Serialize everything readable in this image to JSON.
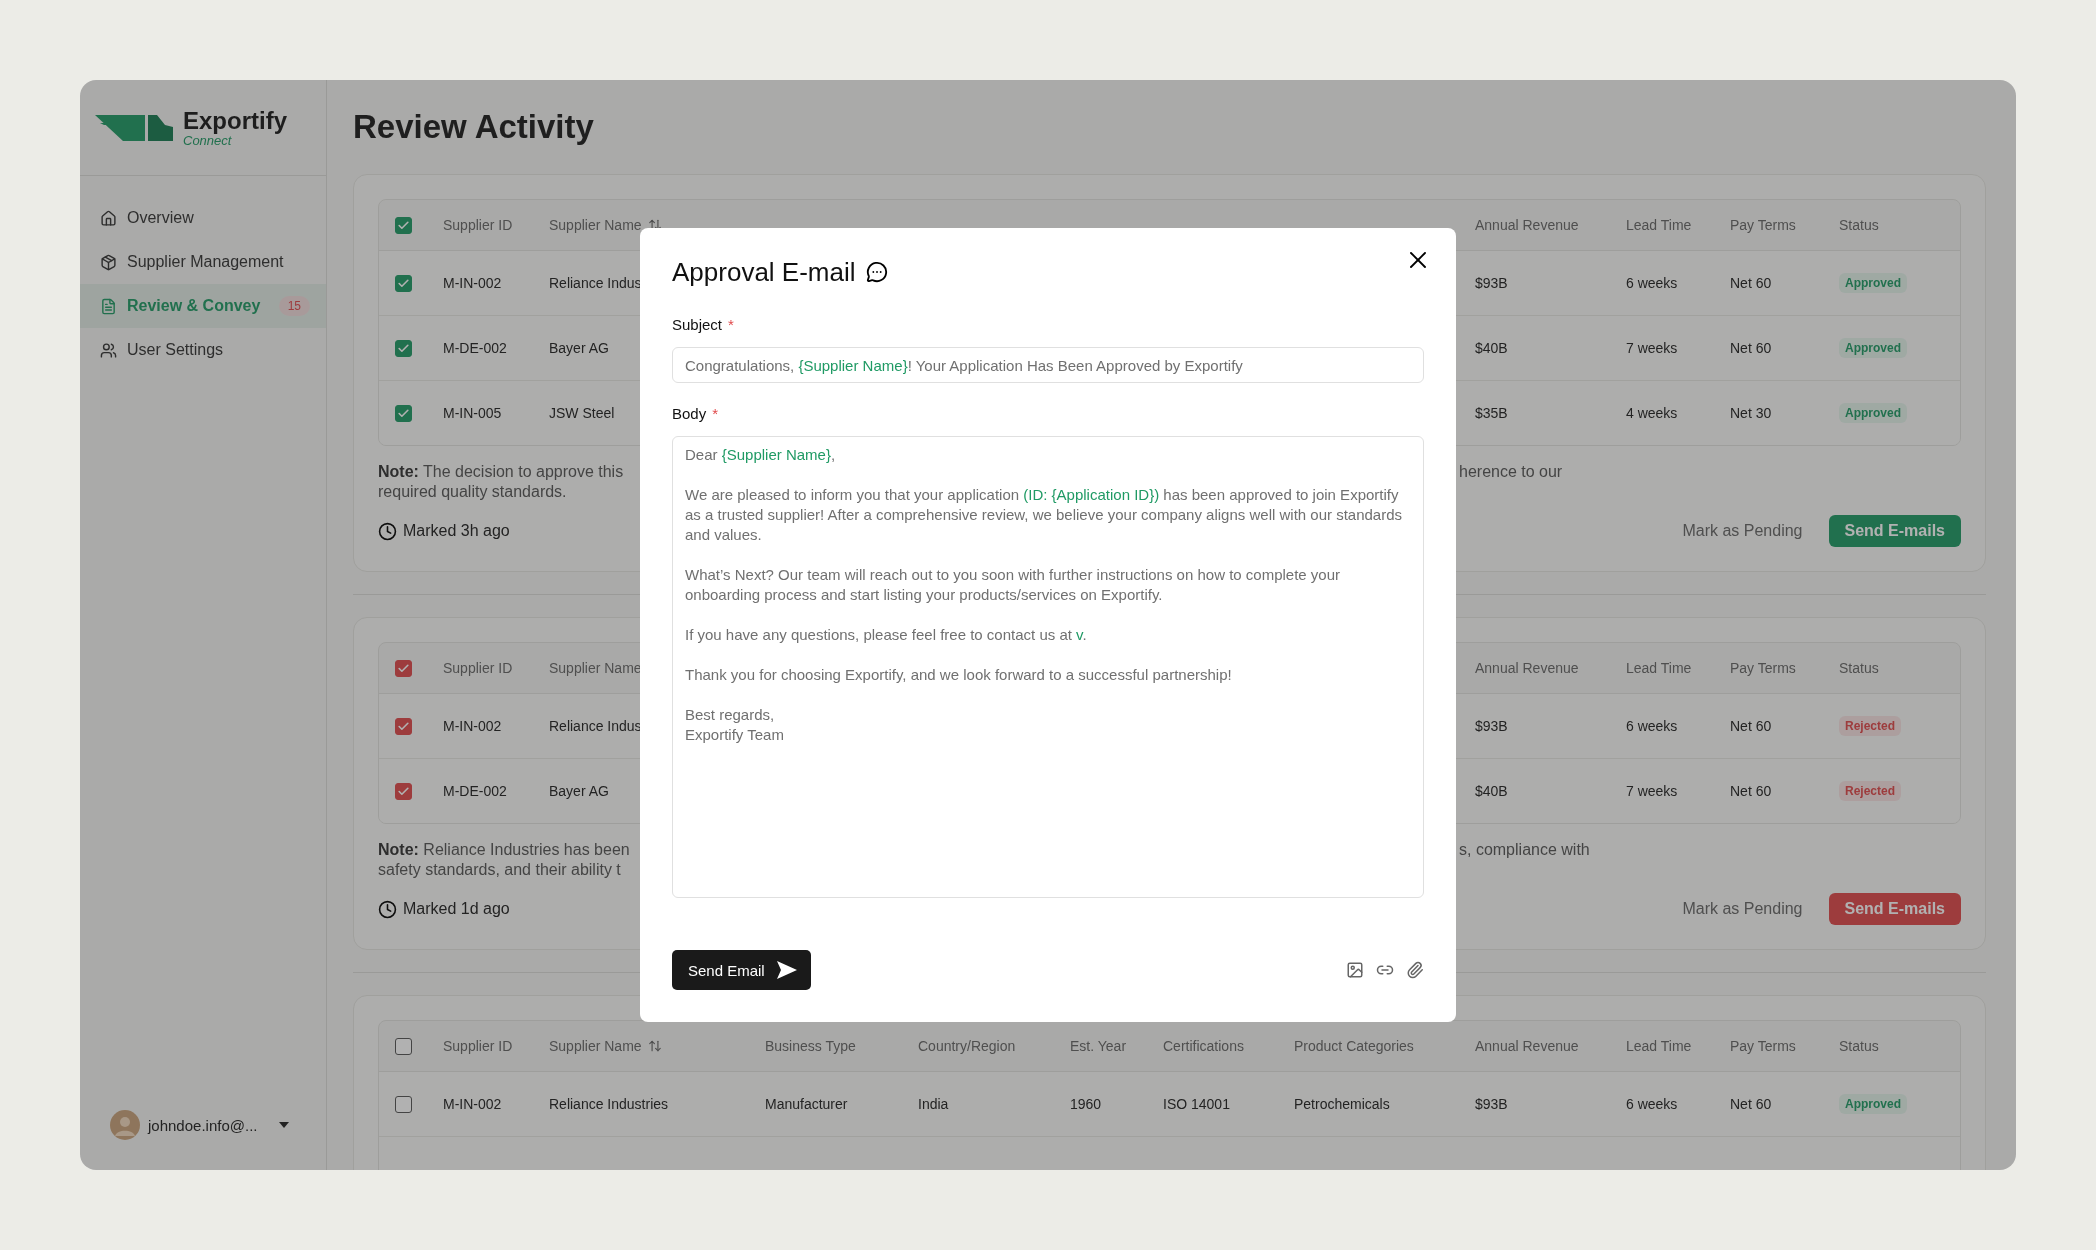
{
  "sidebar": {
    "logo": {
      "name": "Exportify",
      "tagline": "Connect"
    },
    "items": [
      {
        "label": "Overview",
        "selected": false
      },
      {
        "label": "Supplier Management",
        "selected": false
      },
      {
        "label": "Review & Convey",
        "selected": true,
        "badge": "15"
      },
      {
        "label": "User Settings",
        "selected": false
      }
    ],
    "user": {
      "email": "johndoe.info@..."
    }
  },
  "page": {
    "title": "Review Activity"
  },
  "sections": [
    {
      "kind": "approve",
      "table": {
        "checked": true,
        "sort_icon": true,
        "header": {
          "supplier_id": "Supplier ID",
          "supplier_name": "Supplier Name",
          "annual_revenue": "Annual Revenue",
          "lead_time": "Lead Time",
          "pay_terms": "Pay Terms",
          "status": "Status"
        },
        "rows": [
          {
            "checked": true,
            "supplier_id": "M-IN-002",
            "supplier_name": "Reliance Indus",
            "annual_revenue": "$93B",
            "lead_time": "6 weeks",
            "pay_terms": "Net 60",
            "status": {
              "text": "Approved",
              "kind": "approved"
            }
          },
          {
            "checked": true,
            "supplier_id": "M-DE-002",
            "supplier_name": "Bayer AG",
            "annual_revenue": "$40B",
            "lead_time": "7 weeks",
            "pay_terms": "Net 60",
            "status": {
              "text": "Approved",
              "kind": "approved"
            }
          },
          {
            "checked": true,
            "supplier_id": "M-IN-005",
            "supplier_name": "JSW Steel",
            "annual_revenue": "$35B",
            "lead_time": "4 weeks",
            "pay_terms": "Net 30",
            "status": {
              "text": "Approved",
              "kind": "approved"
            }
          }
        ]
      },
      "note": {
        "lines": [
          "**Note:** The decision to approve this",
          "required quality standards."
        ],
        "aside": "herence to our"
      },
      "marked": "Marked 3h ago",
      "actions": [
        {
          "label": "Mark as Pending",
          "kind": "secondary"
        },
        {
          "label": "Send E-mails",
          "kind": "primary"
        }
      ]
    },
    {
      "kind": "reject",
      "table": {
        "checked": true,
        "header": {
          "supplier_id": "Supplier ID",
          "supplier_name": "Supplier Name",
          "annual_revenue": "Annual Revenue",
          "lead_time": "Lead Time",
          "pay_terms": "Pay Terms",
          "status": "Status"
        },
        "rows": [
          {
            "checked": true,
            "supplier_id": "M-IN-002",
            "supplier_name": "Reliance Indus",
            "annual_revenue": "$93B",
            "lead_time": "6 weeks",
            "pay_terms": "Net 60",
            "status": {
              "text": "Rejected",
              "kind": "rejected"
            }
          },
          {
            "checked": true,
            "supplier_id": "M-DE-002",
            "supplier_name": "Bayer AG",
            "annual_revenue": "$40B",
            "lead_time": "7 weeks",
            "pay_terms": "Net 60",
            "status": {
              "text": "Rejected",
              "kind": "rejected"
            }
          }
        ]
      },
      "note": {
        "lines": [
          "**Note:** Reliance Industries has been",
          "safety standards, and their ability t"
        ],
        "aside": "s, compliance with"
      },
      "marked": "Marked 1d ago",
      "actions": [
        {
          "label": "Mark as Pending",
          "kind": "secondary"
        },
        {
          "label": "Send E-mails",
          "kind": "primary"
        }
      ]
    },
    {
      "table": {
        "checked": false,
        "sort_icon": true,
        "header": {
          "supplier_id": "Supplier ID",
          "supplier_name": "Supplier Name",
          "business_type": "Business Type",
          "country_region": "Country/Region",
          "est_year": "Est. Year",
          "certifications": "Certifications",
          "product_categories": "Product Categories",
          "annual_revenue": "Annual Revenue",
          "lead_time": "Lead Time",
          "pay_terms": "Pay Terms",
          "status": "Status"
        },
        "rows": [
          {
            "checked": false,
            "supplier_id": "M-IN-002",
            "supplier_name": "Reliance Industries",
            "business_type": "Manufacturer",
            "country_region": "India",
            "est_year": "1960",
            "certifications": "ISO 14001",
            "product_categories": "Petrochemicals",
            "annual_revenue": "$93B",
            "lead_time": "6 weeks",
            "pay_terms": "Net 60",
            "status": {
              "text": "Approved",
              "kind": "approved"
            }
          }
        ]
      }
    }
  ],
  "modal": {
    "title": "Approval E-mail",
    "subject": {
      "label": "Subject",
      "required_mark": "*",
      "parts": [
        {
          "text": "Congratulations, ",
          "variable": false
        },
        {
          "text": "{Supplier Name}",
          "variable": true
        },
        {
          "text": "! Your Application Has Been Approved by Exportify",
          "variable": false
        }
      ]
    },
    "body": {
      "label": "Body",
      "required_mark": "*",
      "paragraphs": [
        [
          {
            "text": "Dear ",
            "variable": false
          },
          {
            "text": "{Supplier Name}",
            "variable": true
          },
          {
            "text": ",",
            "variable": false
          }
        ],
        [
          {
            "text": "We are pleased to inform you that your application ",
            "variable": false
          },
          {
            "text": "(ID: {Application ID})",
            "variable": true
          },
          {
            "text": " has been approved to join Exportify as a trusted supplier! After a comprehensive review, we believe your company aligns well with our standards and values.",
            "variable": false
          }
        ],
        [
          {
            "text": "What’s Next? Our team will reach out to you soon with further instructions on how to complete your onboarding process and start listing your products/services on Exportify.",
            "variable": false
          }
        ],
        [
          {
            "text": "If you have any questions, please feel free to contact us at ",
            "variable": false
          },
          {
            "text": "v",
            "variable": true
          },
          {
            "text": ".",
            "variable": false
          }
        ],
        [
          {
            "text": "Thank you for choosing Exportify, and we look forward to a successful partnership!",
            "variable": false
          }
        ],
        [
          {
            "text": "Best regards,\nExportify Team",
            "variable": false
          }
        ]
      ]
    },
    "send_button": "Send Email"
  }
}
